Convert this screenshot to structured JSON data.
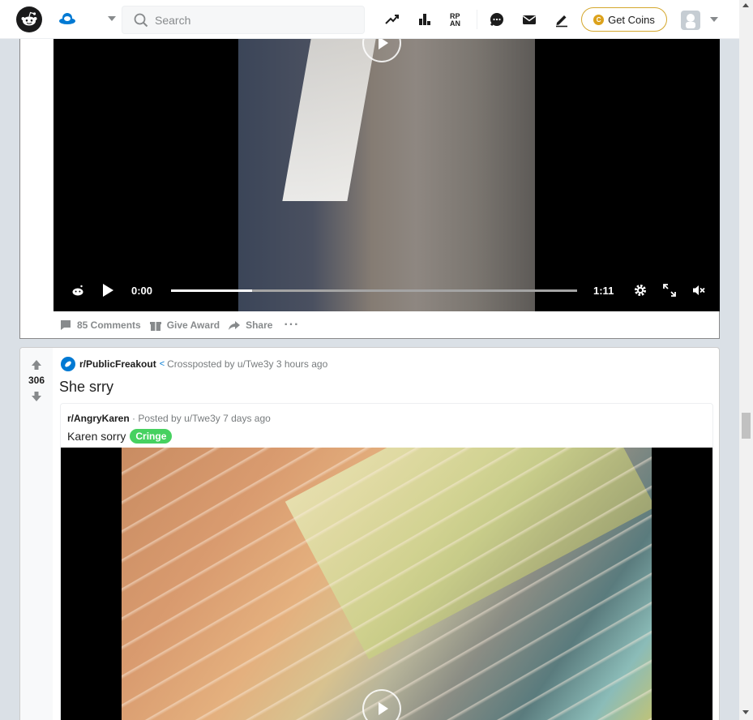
{
  "header": {
    "search_placeholder": "Search",
    "coins_label": "Get Coins"
  },
  "post1": {
    "video": {
      "current_time": "0:00",
      "duration": "1:11",
      "buffered_fraction": 0.2
    },
    "actions": {
      "comments": "85 Comments",
      "award": "Give Award",
      "share": "Share",
      "more": "···"
    }
  },
  "post2": {
    "score": "306",
    "subreddit": "r/PublicFreakout",
    "crosspost_text": "Crossposted by u/Twe3y",
    "time": "3 hours ago",
    "title": "She srry",
    "original": {
      "subreddit": "r/AngryKaren",
      "posted_by": "· Posted by u/Twe3y 7 days ago",
      "title": "Karen sorry",
      "flair": "Cringe"
    }
  },
  "colors": {
    "brand": "#ff4500",
    "accent_blue": "#0079d3",
    "flair_green": "#46d160",
    "coin_gold": "#dca21c"
  }
}
